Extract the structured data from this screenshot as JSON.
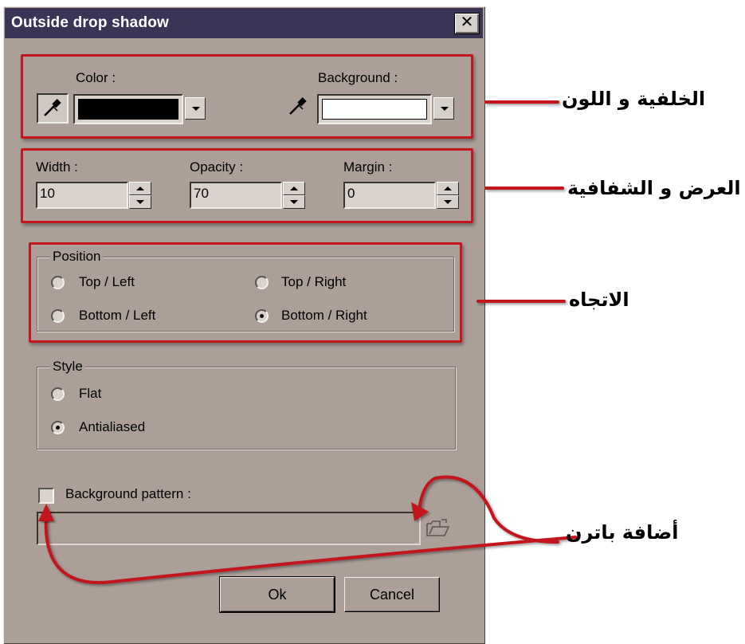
{
  "window": {
    "title": "Outside drop shadow",
    "close_glyph": "✕"
  },
  "colors": {
    "label": "Color :",
    "value": "#000000"
  },
  "background": {
    "label": "Background :",
    "value": "#ffffff"
  },
  "width": {
    "label": "Width :",
    "value": "10"
  },
  "opacity": {
    "label": "Opacity :",
    "value": "70"
  },
  "margin": {
    "label": "Margin :",
    "value": "0"
  },
  "position": {
    "title": "Position",
    "options": [
      "Top / Left",
      "Top / Right",
      "Bottom / Left",
      "Bottom / Right"
    ],
    "selected": "Bottom / Right"
  },
  "style": {
    "title": "Style",
    "options": [
      "Flat",
      "Antialiased"
    ],
    "selected": "Antialiased"
  },
  "pattern": {
    "label": "Background pattern :",
    "checked": false,
    "path": ""
  },
  "buttons": {
    "ok": "Ok",
    "cancel": "Cancel"
  },
  "annotations": {
    "color_bg": "الخلفية و اللون",
    "width_opacity": "العرض و الشفافية",
    "position": "الاتجاه",
    "pattern": "أضافة باترن"
  },
  "accent": {
    "annotation_red": "#c3171e",
    "titlebar": "#3a3556",
    "dialog_bg": "#ab9f98"
  }
}
